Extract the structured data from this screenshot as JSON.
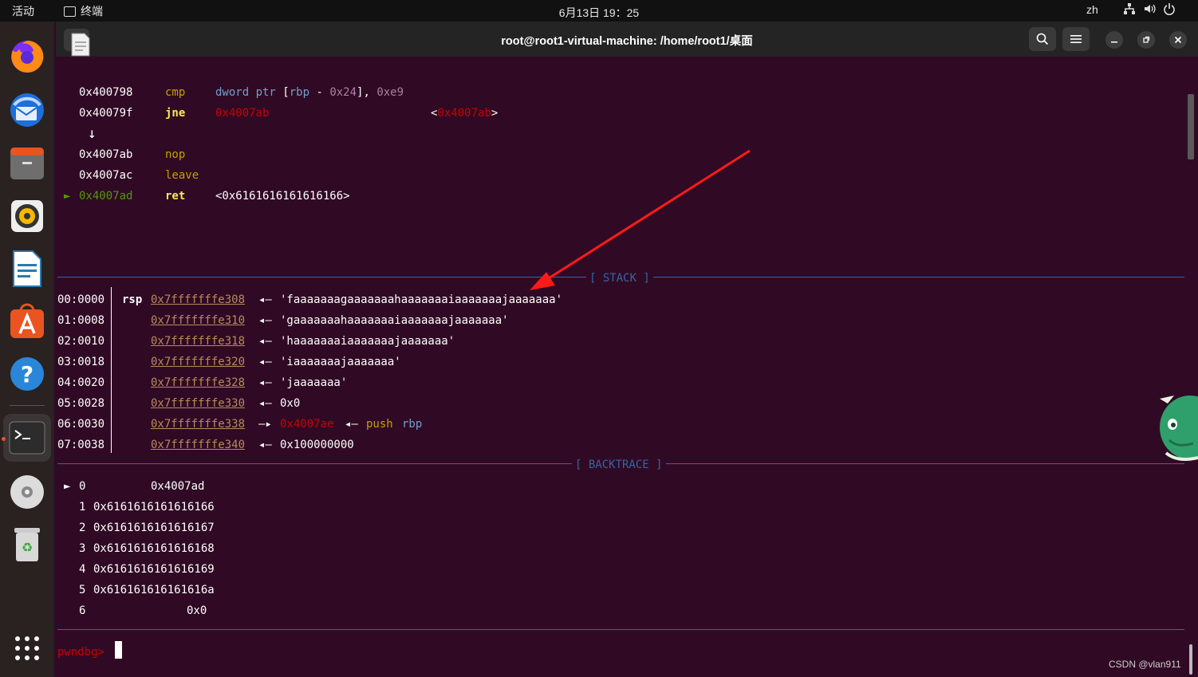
{
  "topbar": {
    "activities": "活动",
    "app_name": "终端",
    "clock": "6月13日  19：25",
    "lang": "zh"
  },
  "window": {
    "title": "root@root1-virtual-machine: /home/root1/桌面"
  },
  "disasm": {
    "rows": [
      {
        "addr": "0x400798",
        "mnem": "cmp",
        "ops": "dword ptr [rbp - 0x24], 0xe9"
      },
      {
        "addr": "0x40079f",
        "mnem": "jne",
        "target": "0x4007ab",
        "comment": "<0x4007ab>"
      },
      {
        "arrow": "↓"
      },
      {
        "addr": "0x4007ab",
        "mnem": "nop"
      },
      {
        "addr": "0x4007ac",
        "mnem": "leave"
      },
      {
        "marker": "►",
        "addr": "0x4007ad",
        "mnem": "ret",
        "ops": "<0x6161616161616166>"
      }
    ]
  },
  "stack": {
    "label": "[ STACK ]",
    "rows": [
      {
        "idx": "00:0000",
        "reg": "rsp",
        "addr": "0x7fffffffe308",
        "arrow": "◂—",
        "value": "'faaaaaaagaaaaaaahaaaaaaaiaaaaaaajaaaaaaa'"
      },
      {
        "idx": "01:0008",
        "reg": "",
        "addr": "0x7fffffffe310",
        "arrow": "◂—",
        "value": "'gaaaaaaahaaaaaaaiaaaaaaajaaaaaaa'"
      },
      {
        "idx": "02:0010",
        "reg": "",
        "addr": "0x7fffffffe318",
        "arrow": "◂—",
        "value": "'haaaaaaaiaaaaaaajaaaaaaa'"
      },
      {
        "idx": "03:0018",
        "reg": "",
        "addr": "0x7fffffffe320",
        "arrow": "◂—",
        "value": "'iaaaaaaajaaaaaaa'"
      },
      {
        "idx": "04:0020",
        "reg": "",
        "addr": "0x7fffffffe328",
        "arrow": "◂—",
        "value": "'jaaaaaaa'"
      },
      {
        "idx": "05:0028",
        "reg": "",
        "addr": "0x7fffffffe330",
        "arrow": "◂—",
        "value": "0x0"
      },
      {
        "idx": "06:0030",
        "reg": "",
        "addr": "0x7fffffffe338",
        "arrow": "—▸",
        "ptr": "0x4007ae",
        "arrow2": "◂—",
        "instr": "push",
        "operand": "rbp"
      },
      {
        "idx": "07:0038",
        "reg": "",
        "addr": "0x7fffffffe340",
        "arrow": "◂—",
        "value": "0x100000000"
      }
    ]
  },
  "backtrace": {
    "label": "[ BACKTRACE ]",
    "rows": [
      {
        "marker": "►",
        "n": "0",
        "addr": "0x4007ad"
      },
      {
        "n": "1",
        "addr": "0x6161616161616166"
      },
      {
        "n": "2",
        "addr": "0x6161616161616167"
      },
      {
        "n": "3",
        "addr": "0x6161616161616168"
      },
      {
        "n": "4",
        "addr": "0x6161616161616169"
      },
      {
        "n": "5",
        "addr": "0x616161616161616a"
      },
      {
        "n": "6",
        "addr": "0x0"
      }
    ]
  },
  "prompt": "pwndbg>",
  "watermark": "CSDN @vlan911",
  "colors": {
    "bg": "#300a24",
    "accent_red": "#ff1a1a",
    "prompt": "#cc0000",
    "section": "#3465a4"
  }
}
